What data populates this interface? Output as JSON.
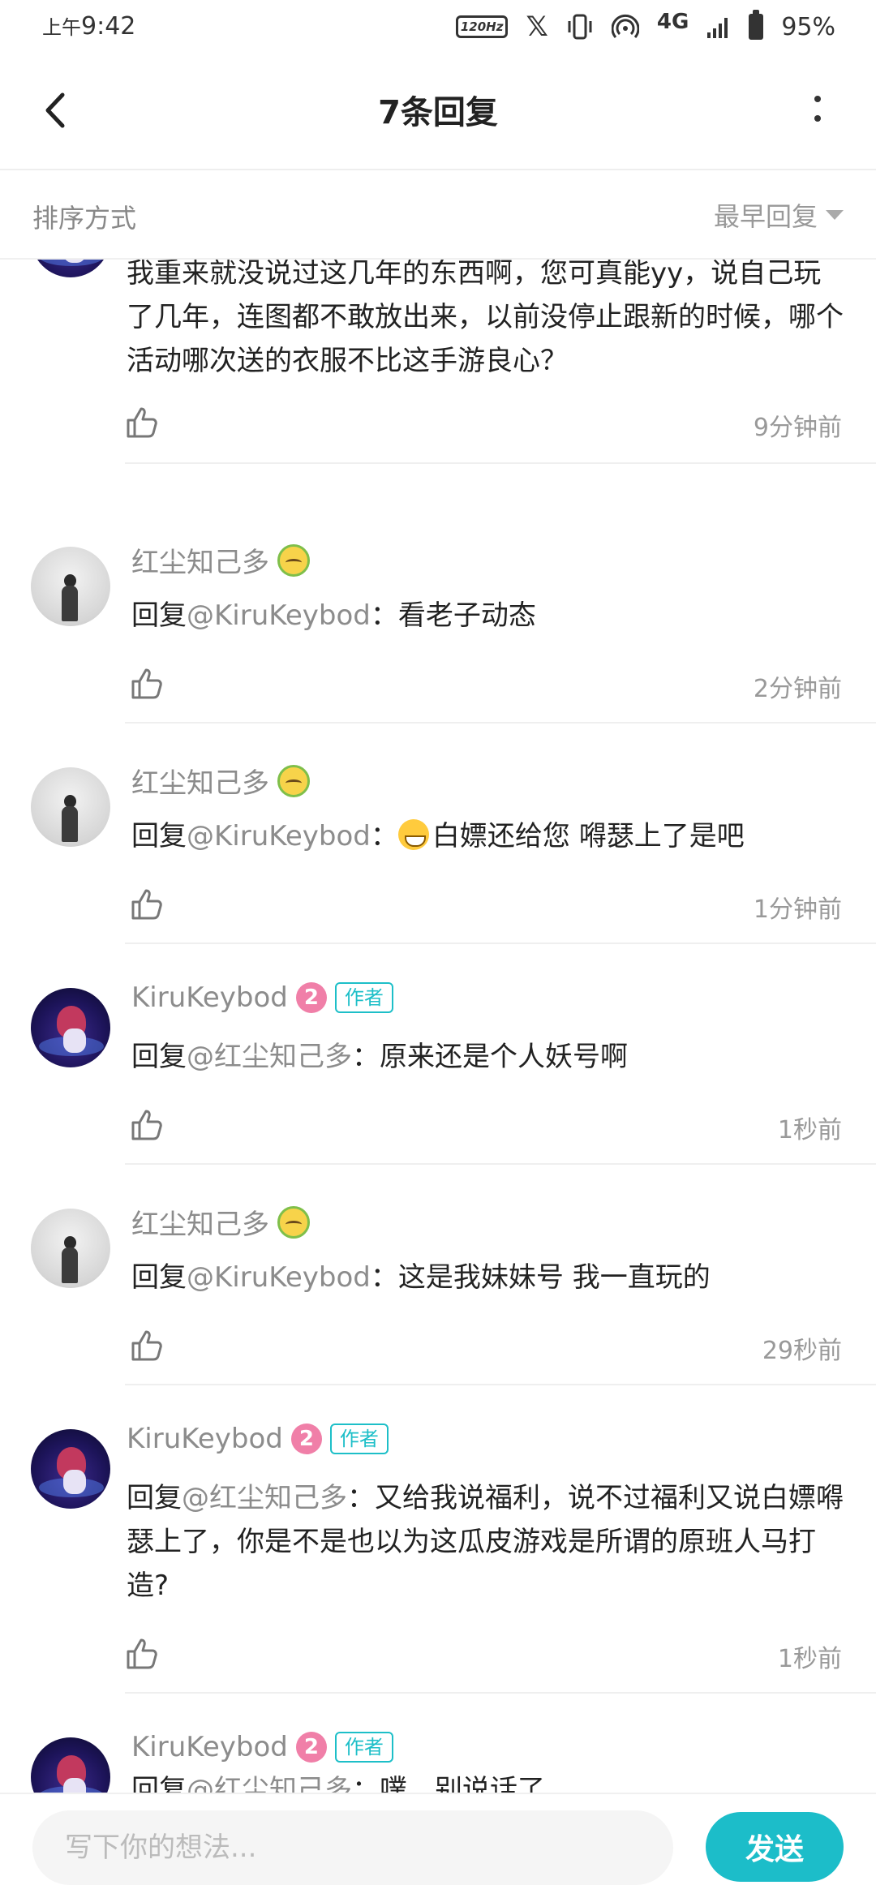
{
  "status_bar": {
    "ampm": "上午",
    "time": "9:42",
    "refresh_rate": "120Hz",
    "network": "4G",
    "battery": "95%"
  },
  "header": {
    "title": "7条回复"
  },
  "sort": {
    "label": "排序方式",
    "selected": "最早回复"
  },
  "comments": [
    {
      "author": "",
      "text": "我重来就没说过这几年的东西啊，您可真能yy，说自己玩了几年，连图都不敢放出来，以前没停止跟新的时候，哪个活动哪次送的衣服不比这手游良心？",
      "time": "9分钟前"
    },
    {
      "author": "红尘知己多",
      "reply_prefix": "回复",
      "mention": "@KiruKeybod",
      "text": "：看老子动态",
      "time": "2分钟前"
    },
    {
      "author": "红尘知己多",
      "reply_prefix": "回复",
      "mention": "@KiruKeybod",
      "text": "白嫖还给您 嘚瑟上了是吧",
      "text_prefix": "：",
      "time": "1分钟前"
    },
    {
      "author": "KiruKeybod",
      "level": "2",
      "tag": "作者",
      "reply_prefix": "回复",
      "mention": "@红尘知己多",
      "text": "：原来还是个人妖号啊",
      "time": "1秒前"
    },
    {
      "author": "红尘知己多",
      "reply_prefix": "回复",
      "mention": "@KiruKeybod",
      "text": "：这是我妹妹号 我一直玩的",
      "time": "29秒前"
    },
    {
      "author": "KiruKeybod",
      "level": "2",
      "tag": "作者",
      "reply_prefix": "回复",
      "mention": "@红尘知己多",
      "text": "：又给我说福利，说不过福利又说白嫖嘚瑟上了，你是不是也以为这瓜皮游戏是所谓的原班人马打造?",
      "time": "1秒前"
    },
    {
      "author": "KiruKeybod",
      "level": "2",
      "tag": "作者",
      "reply_prefix": "回复",
      "mention": "@红尘知己多",
      "text": "：噗，别说话了"
    }
  ],
  "composer": {
    "placeholder": "写下你的想法...",
    "send_label": "发送"
  },
  "colors": {
    "accent": "#1cbdc9",
    "level_badge": "#f07fa8",
    "muted_text": "#8c8c8c"
  },
  "icons": [
    "back-arrow-icon",
    "more-vertical-icon",
    "chevron-down-icon",
    "thumbs-up-icon",
    "vibrate-icon",
    "hotspot-icon",
    "signal-icon",
    "battery-icon",
    "x-logo-icon",
    "refresh-rate-icon"
  ]
}
